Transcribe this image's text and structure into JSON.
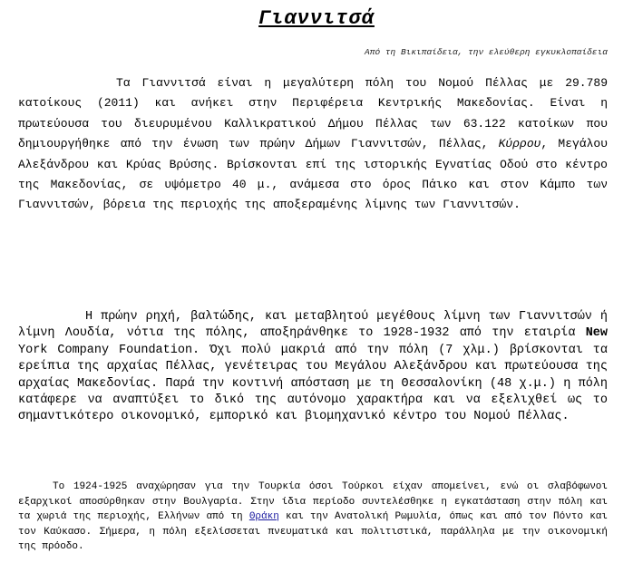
{
  "title": "Γιαννιτσά",
  "subtitle": "Από τη Βικιπαίδεια, την ελεύθερη εγκυκλοπαίδεια",
  "p1": {
    "a": "Τα Γιαννιτσά είναι η μεγαλύτερη πόλη του Νομού Πέλλας με 29.789 κατοίκους (2011) και ανήκει στην Περιφέρεια Κεντρικής Μακεδονίας. Είναι η πρωτεύουσα του διευρυμένου Καλλικρατικού Δήμου Πέλλας των 63.122 κατοίκων που δημιουργήθηκε από την ένωση των πρώην Δήμων Γιαννιτσών, Πέλλας, ",
    "kyrrou": "Κύρρου",
    "b": ", Μεγάλου Αλεξάνδρου και Κρύας Βρύσης. Βρίσκονται επί της ιστορικής Εγνατίας Οδού στο κέντρο της Μακεδονίας, σε υψόμετρο 40 μ., ανάμεσα στο όρος Πάικο και στον Κάμπο των Γιαννιτσών, βόρεια της περιοχής της αποξεραμένης λίμνης των Γιαννιτσών."
  },
  "p2": {
    "a": "Η πρώην ρηχή, βαλτώδης, και μεταβλητού μεγέθους λίμνη των Γιαννιτσών ή λίμνη Λουδία, νότια της πόλης, αποξηράνθηκε το 1928-1932 από την εταιρία ",
    "new": "New",
    "b": " York Company Foundation. Όχι πολύ μακριά από την πόλη (7 χλμ.) βρίσκονται τα ερείπια της αρχαίας Πέλλας, γενέτειρας του Μεγάλου Αλεξάνδρου και πρωτεύουσα της αρχαίας Μακεδονίας. Παρά την κοντινή απόσταση με τη Θεσσαλονίκη (48 χ.μ.) η πόλη κατάφερε να αναπτύξει το δικό της αυτόνομο χαρακτήρα και να εξελιχθεί ως το σημαντικότερο οικονομικό, εμπορικό και βιομηχανικό κέντρο του Νομού Πέλλας."
  },
  "p3": {
    "a": "Το 1924-1925 αναχώρησαν για την Τουρκία όσοι Τούρκοι είχαν απομείνει, ενώ οι σλαβόφωνοι εξαρχικοί αποσύρθηκαν στην Βουλγαρία. Στην ίδια περίοδο συντελέσθηκε η εγκατάσταση στην πόλη και τα χωριά της περιοχής, Ελλήνων από τη ",
    "thraki": "Θράκη",
    "b": " και την Ανατολική Ρωμυλία, όπως και από τον Πόντο και τον Καύκασο. Σήμερα, η πόλη εξελίσσεται πνευματικά και πολιτιστικά, παράλληλα με την οικονομική της πρόοδο."
  }
}
